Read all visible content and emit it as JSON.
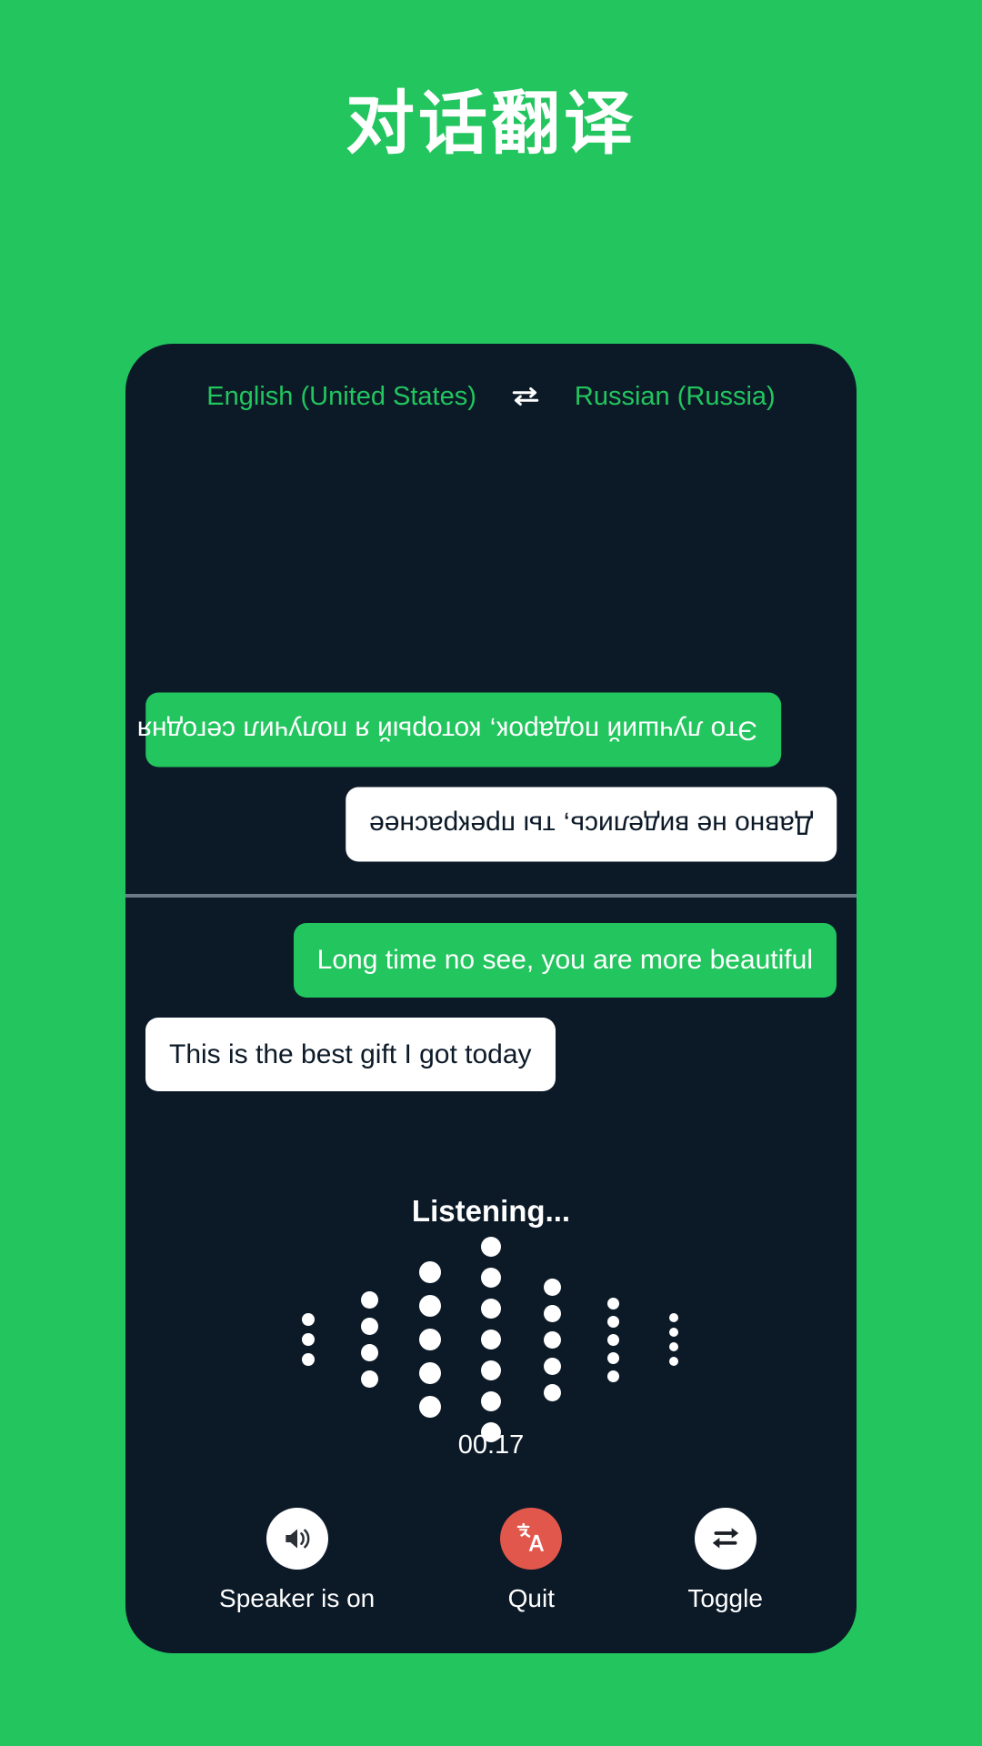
{
  "page": {
    "title": "对话翻译",
    "background_color": "#22c55e",
    "card_background_color": "#0c1a28",
    "accent_color": "#22c55e",
    "quit_color": "#e2574c"
  },
  "language_bar": {
    "source_language": "English (United States)",
    "target_language": "Russian (Russia)",
    "swap_icon": "swap-horizontal-icon"
  },
  "conversation": {
    "top_pane": [
      {
        "text": "Это лучший подарок, который я получил сегодня",
        "style": "green",
        "align": "left",
        "rotated": true
      },
      {
        "text": "Давно не виделись, ты прекраснее",
        "style": "white",
        "align": "right",
        "rotated": true
      }
    ],
    "bottom_pane": [
      {
        "text": "Long time no see, you are more beautiful",
        "style": "green",
        "align": "right",
        "rotated": false
      },
      {
        "text": "This is the best gift I got today",
        "style": "white",
        "align": "left",
        "rotated": false
      }
    ]
  },
  "status": {
    "listening_label": "Listening...",
    "timer": "00:17"
  },
  "waveform": {
    "columns": [
      {
        "dots": 3,
        "size": 14
      },
      {
        "dots": 4,
        "size": 19
      },
      {
        "dots": 5,
        "size": 24
      },
      {
        "dots": 7,
        "size": 22
      },
      {
        "dots": 5,
        "size": 19
      },
      {
        "dots": 5,
        "size": 13
      },
      {
        "dots": 4,
        "size": 10
      }
    ],
    "dot_color": "#ffffff"
  },
  "controls": [
    {
      "label": "Speaker is on",
      "icon": "speaker-on-icon",
      "circle_style": "white"
    },
    {
      "label": "Quit",
      "icon": "translate-icon",
      "circle_style": "red"
    },
    {
      "label": "Toggle",
      "icon": "repeat-icon",
      "circle_style": "white"
    }
  ]
}
